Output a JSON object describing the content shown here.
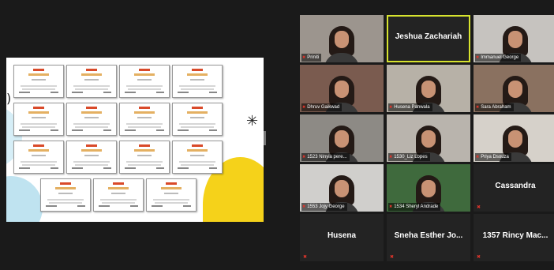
{
  "shared_screen": {
    "certificate_count": 15,
    "accent_colors": {
      "logo": "#d94a2a",
      "title": "#e4b062",
      "shape_yellow": "#f5d21a",
      "shape_blue": "#bfe3f0"
    }
  },
  "gallery": {
    "active_color": "#d7e32e",
    "tiles": [
      {
        "name": "Priniti",
        "video": true,
        "muted": true,
        "bg": "#9c958e"
      },
      {
        "name": "Jeshua Zachariah",
        "video": false,
        "muted": false,
        "active": true
      },
      {
        "name": "Immanuel George",
        "video": true,
        "muted": true,
        "bg": "#c6c3bf"
      },
      {
        "name": "Dhruv Gaikwad",
        "video": true,
        "muted": true,
        "bg": "#7a5b4f"
      },
      {
        "name": "Husena Panwala",
        "video": true,
        "muted": true,
        "bg": "#b7b1a7"
      },
      {
        "name": "Sara Abraham",
        "video": true,
        "muted": true,
        "bg": "#8a7160"
      },
      {
        "name": "1523 Ninyia pere...",
        "video": true,
        "muted": true,
        "bg": "#8d8a85"
      },
      {
        "name": "1530_Liz Lopes",
        "video": true,
        "muted": true,
        "bg": "#b9b4ad"
      },
      {
        "name": "Priya Dsouza",
        "video": true,
        "muted": true,
        "bg": "#d6d1ca"
      },
      {
        "name": "1553 Jojy George",
        "video": true,
        "muted": true,
        "bg": "#d0cfcc"
      },
      {
        "name": "1534 Sheryl Andrade",
        "video": true,
        "muted": true,
        "bg": "#3f6a3d"
      },
      {
        "name": "Cassandra",
        "video": false,
        "muted": true
      },
      {
        "name": "Husena",
        "video": false,
        "muted": true
      },
      {
        "name": "Sneha Esther Jo...",
        "video": false,
        "muted": true
      },
      {
        "name": "1357 Rincy Mac...",
        "video": false,
        "muted": true
      }
    ]
  },
  "icons": {
    "muted_mic": "mic-muted-icon"
  }
}
